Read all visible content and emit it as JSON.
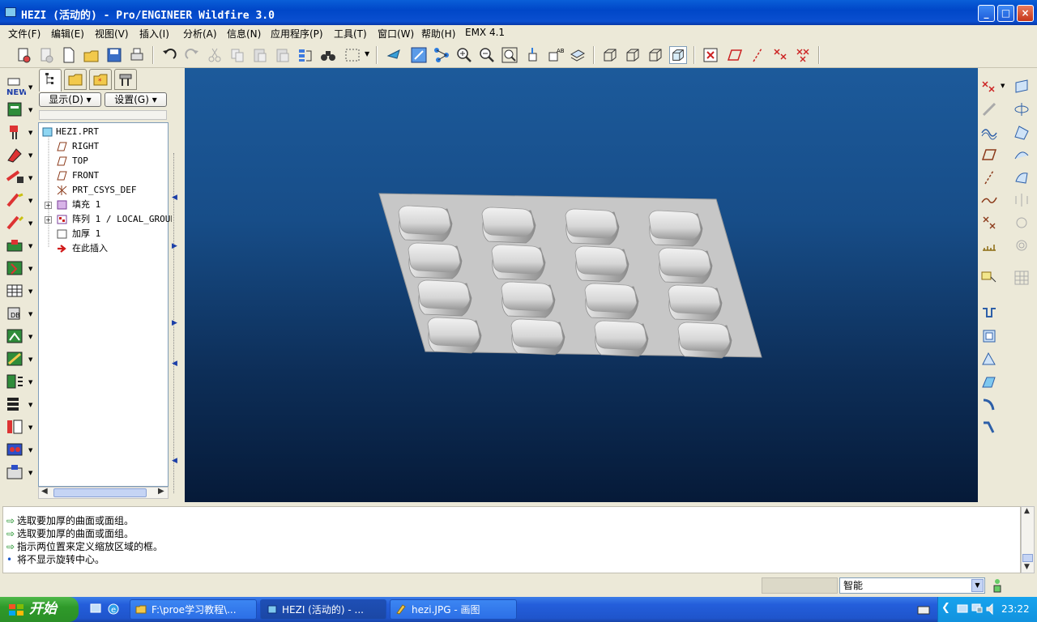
{
  "window": {
    "title": "HEZI (活动的) - Pro/ENGINEER Wildfire 3.0",
    "min_glyph": "_",
    "max_glyph": "□",
    "close_glyph": "×"
  },
  "menu": [
    "文件(F)",
    "编辑(E)",
    "视图(V)",
    "插入(I)",
    "分析(A)",
    "信息(N)",
    "应用程序(P)",
    "工具(T)",
    "窗口(W)",
    "帮助(H)",
    "EMX 4.1"
  ],
  "panel": {
    "show_button": "显示(D) ▾",
    "settings_button": "设置(G) ▾",
    "tree": [
      {
        "label": "HEZI.PRT",
        "icon": "part-icon",
        "indent": 0
      },
      {
        "label": "RIGHT",
        "icon": "datum-plane-icon",
        "indent": 1
      },
      {
        "label": "TOP",
        "icon": "datum-plane-icon",
        "indent": 1
      },
      {
        "label": "FRONT",
        "icon": "datum-plane-icon",
        "indent": 1
      },
      {
        "label": "PRT_CSYS_DEF",
        "icon": "csys-icon",
        "indent": 1
      },
      {
        "label": "填充 1",
        "icon": "fill-icon",
        "indent": 1,
        "expandable": true
      },
      {
        "label": "阵列 1 / LOCAL_GROUP",
        "icon": "pattern-icon",
        "indent": 1,
        "expandable": true
      },
      {
        "label": "加厚 1",
        "icon": "thicken-icon",
        "indent": 1
      },
      {
        "label": "在此插入",
        "icon": "insert-here-icon",
        "indent": 1
      }
    ]
  },
  "messages": [
    {
      "glyph": "⇨",
      "text": "选取要加厚的曲面或面组。"
    },
    {
      "glyph": "⇨",
      "text": "选取要加厚的曲面或面组。"
    },
    {
      "glyph": "⇨",
      "text": "指示两位置来定义缩放区域的框。"
    },
    {
      "glyph": "•",
      "text": "将不显示旋转中心。"
    }
  ],
  "status": {
    "filter": "智能"
  },
  "taskbar": {
    "start": "开始",
    "tasks": [
      "F:\\proe学习教程\\...",
      "HEZI (活动的) - ...",
      "hezi.JPG - 画图"
    ],
    "clock": "23:22"
  },
  "colors": {
    "viewport_top": "#1c5a9b",
    "viewport_bottom": "#061a38",
    "part_gray": "#c7c7c7",
    "titlebar": "#0047c8"
  }
}
